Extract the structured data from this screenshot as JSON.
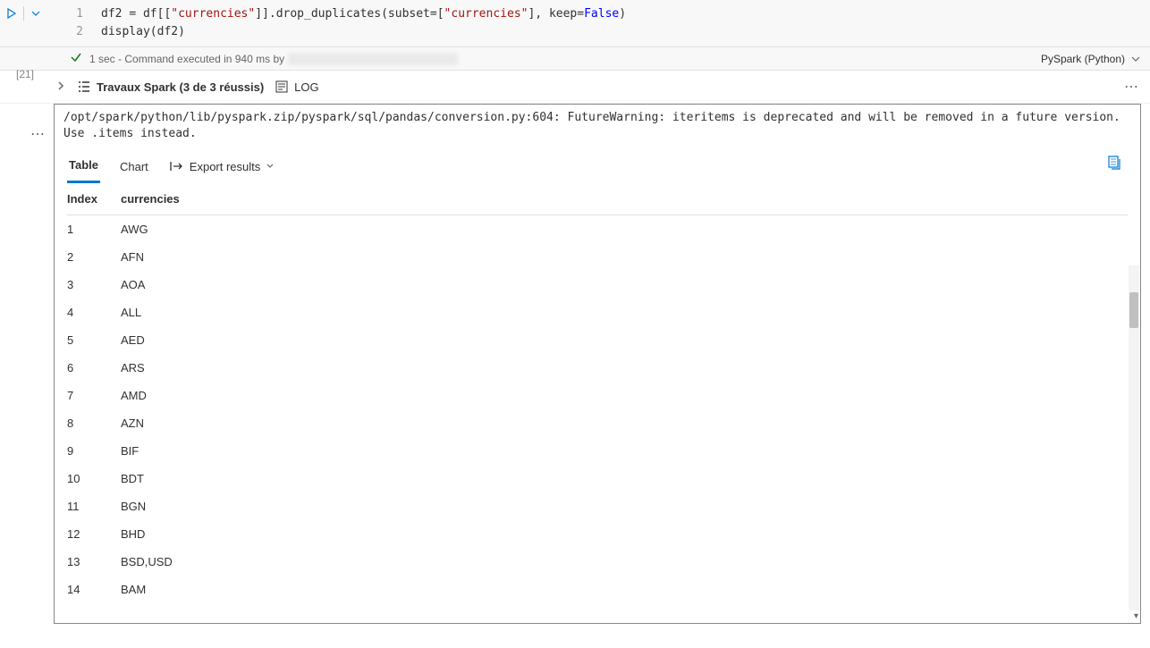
{
  "cell": {
    "execution_count": "[21]",
    "code_lines": [
      "df2 = df[[\"currencies\"]].drop_duplicates(subset=[\"currencies\"], keep=False)",
      "display(df2)"
    ]
  },
  "status": {
    "duration_text": "1 sec",
    "message": "- Command executed in 940 ms by"
  },
  "kernel": {
    "label": "PySpark (Python)"
  },
  "output_toolbar": {
    "spark_jobs": "Travaux Spark (3 de 3 réussis)",
    "log_label": "LOG"
  },
  "warning": "/opt/spark/python/lib/pyspark.zip/pyspark/sql/pandas/conversion.py:604: FutureWarning: iteritems is deprecated and will be removed in a future version. Use .items instead.",
  "tabs": {
    "table": "Table",
    "chart": "Chart",
    "export": "Export results"
  },
  "table": {
    "headers": {
      "index": "Index",
      "currencies": "currencies"
    },
    "rows": [
      {
        "index": "1",
        "currencies": "AWG"
      },
      {
        "index": "2",
        "currencies": "AFN"
      },
      {
        "index": "3",
        "currencies": "AOA"
      },
      {
        "index": "4",
        "currencies": "ALL"
      },
      {
        "index": "5",
        "currencies": "AED"
      },
      {
        "index": "6",
        "currencies": "ARS"
      },
      {
        "index": "7",
        "currencies": "AMD"
      },
      {
        "index": "8",
        "currencies": "AZN"
      },
      {
        "index": "9",
        "currencies": "BIF"
      },
      {
        "index": "10",
        "currencies": "BDT"
      },
      {
        "index": "11",
        "currencies": "BGN"
      },
      {
        "index": "12",
        "currencies": "BHD"
      },
      {
        "index": "13",
        "currencies": "BSD,USD"
      },
      {
        "index": "14",
        "currencies": "BAM"
      }
    ]
  }
}
